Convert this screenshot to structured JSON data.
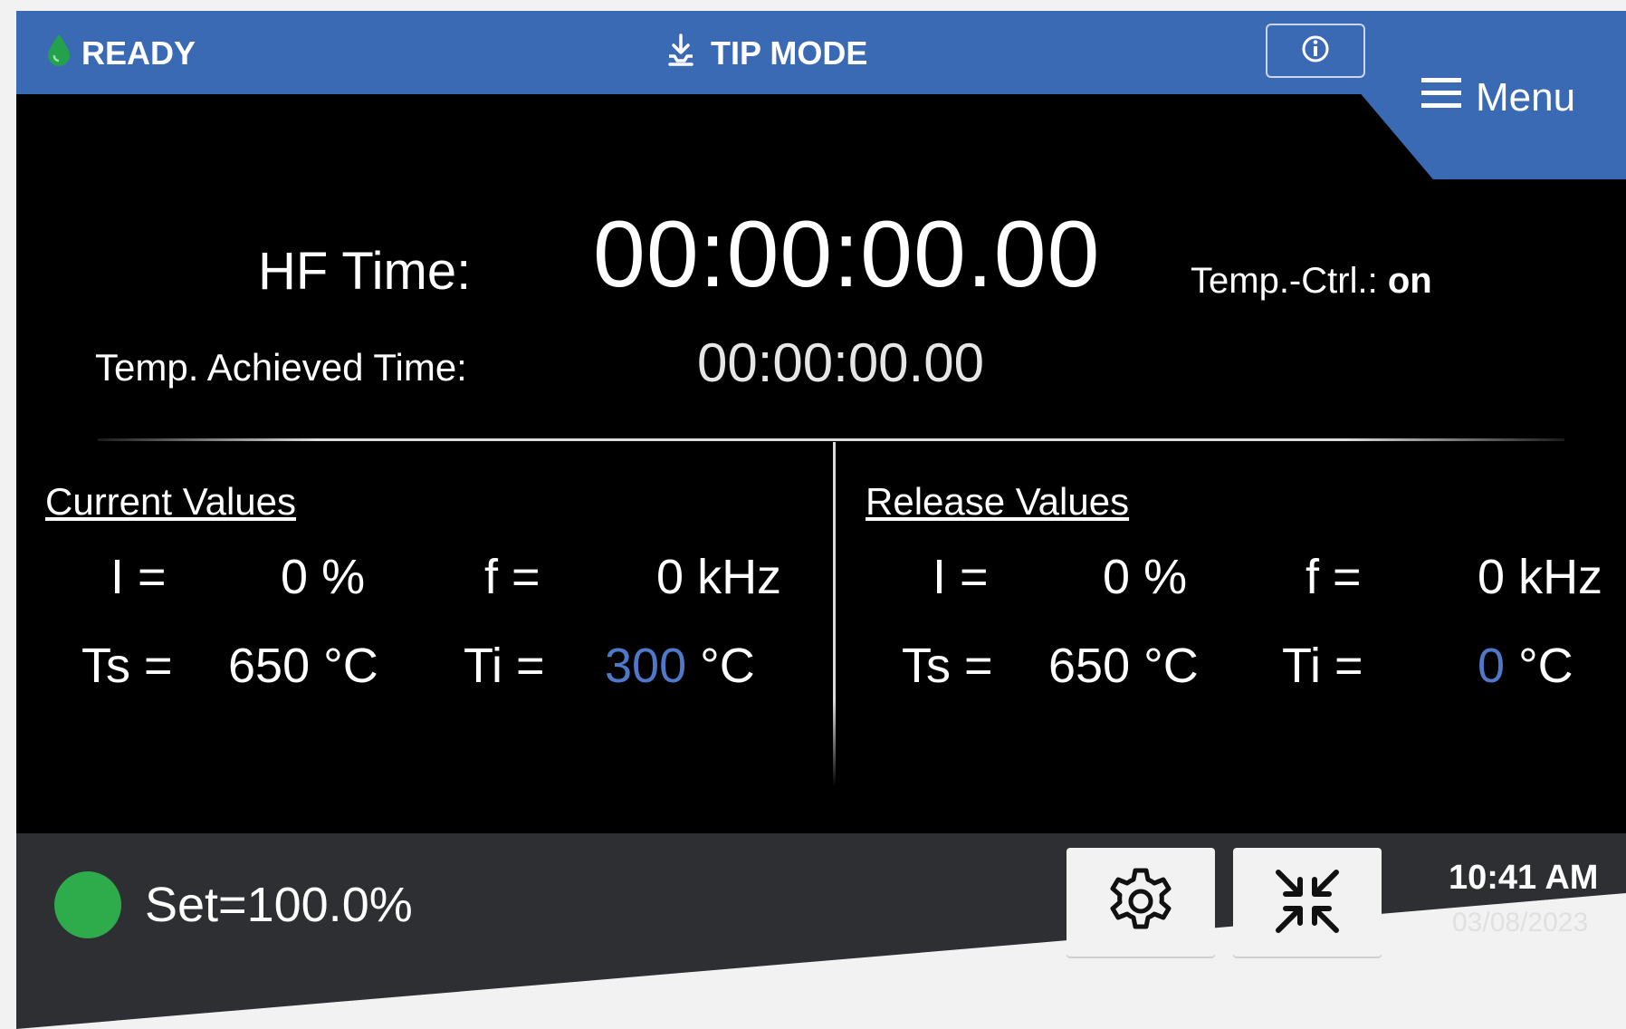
{
  "header": {
    "status": "READY",
    "mode": "TIP MODE",
    "menu_label": "Menu"
  },
  "timers": {
    "hf_label": "HF Time:",
    "hf_time": "00:00:00.00",
    "temp_ctrl_label": "Temp.-Ctrl.:",
    "temp_ctrl_value": "on",
    "achieved_label": "Temp. Achieved Time:",
    "achieved_time": "00:00:00.00"
  },
  "current": {
    "title": "Current Values",
    "i_label": "I =",
    "i_value": "0",
    "i_unit": "%",
    "f_label": "f =",
    "f_value": "0",
    "f_unit": "kHz",
    "ts_label": "Ts =",
    "ts_value": "650",
    "ts_unit": "°C",
    "ti_label": "Ti =",
    "ti_value": "300",
    "ti_unit": "°C"
  },
  "release": {
    "title": "Release Values",
    "i_label": "I =",
    "i_value": "0",
    "i_unit": "%",
    "f_label": "f =",
    "f_value": "0",
    "f_unit": "kHz",
    "ts_label": "Ts =",
    "ts_value": "650",
    "ts_unit": "°C",
    "ti_label": "Ti =",
    "ti_value": "0",
    "ti_unit": "°C"
  },
  "footer": {
    "set_text": "Set=100.0%",
    "time": "10:41 AM",
    "date": "03/08/2023"
  },
  "colors": {
    "header_blue": "#3b6ab5",
    "status_green": "#2eab4a",
    "value_blue": "#4f78c9"
  },
  "icons": {
    "status": "water-drop-icon",
    "mode": "tip-download-icon",
    "info": "info-icon",
    "menu": "hamburger-icon",
    "settings": "gear-icon",
    "collapse": "collapse-arrows-icon"
  }
}
